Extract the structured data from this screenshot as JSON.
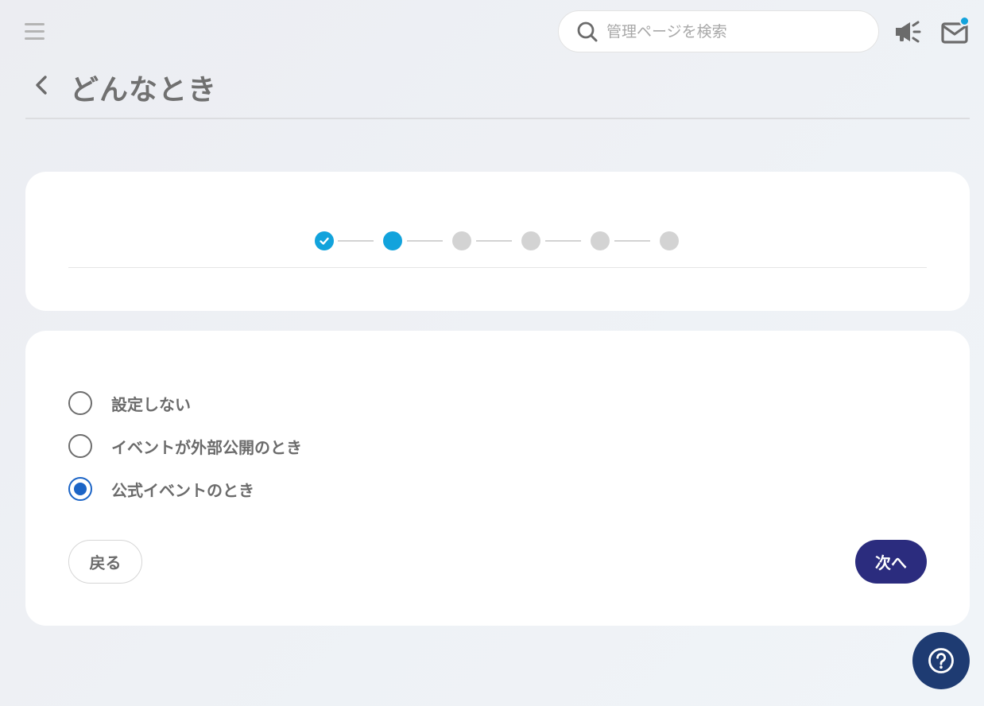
{
  "header": {
    "search_placeholder": "管理ページを検索",
    "mail_has_unread": true
  },
  "page": {
    "title": "どんなとき"
  },
  "stepper": {
    "total_steps": 6,
    "current_step": 2,
    "completed_steps": 1
  },
  "options": [
    {
      "label": "設定しない",
      "checked": false
    },
    {
      "label": "イベントが外部公開のとき",
      "checked": false
    },
    {
      "label": "公式イベントのとき",
      "checked": true
    }
  ],
  "buttons": {
    "back_label": "戻る",
    "next_label": "次へ"
  },
  "colors": {
    "accent": "#12a3dc",
    "primary_button": "#2b2c7e",
    "radio_selected": "#1b64c6",
    "help_button": "#1e3b72"
  },
  "icons": [
    "menu-icon",
    "search-icon",
    "megaphone-icon",
    "mail-icon",
    "chevron-left-icon",
    "check-icon",
    "help-icon"
  ]
}
